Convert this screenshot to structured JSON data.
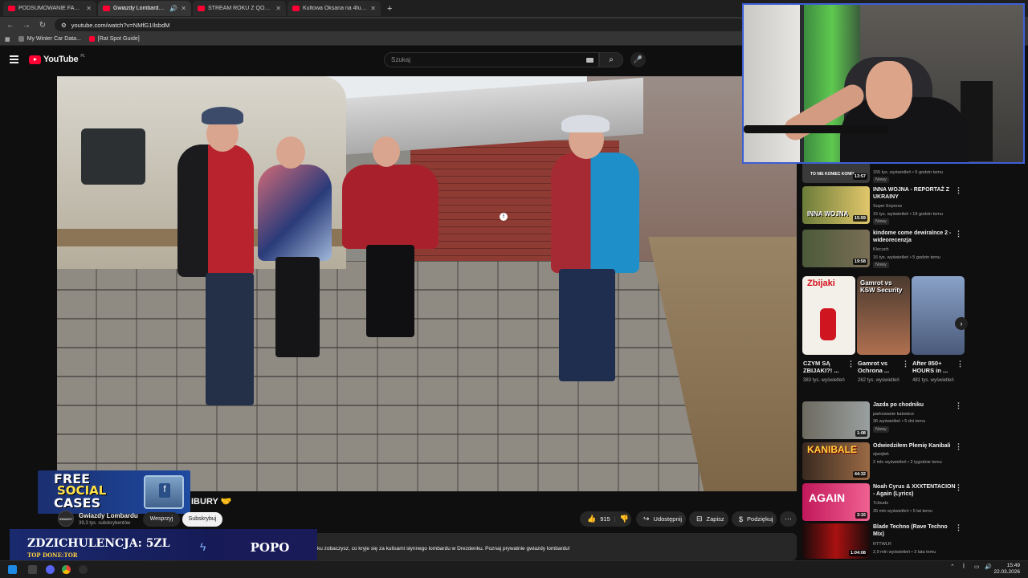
{
  "tabs": [
    {
      "title": "PODSUMOWANIE FAME 30 (Dł",
      "active": false
    },
    {
      "title": "Gwiazdy Lombardu: Gramy",
      "active": true
    },
    {
      "title": "STREAM ROKU Z QOOSIK | WS",
      "active": false
    },
    {
      "title": "Kultowa Oksana na 4fun.tv - dy",
      "active": false
    }
  ],
  "url": "youtube.com/watch?v=NMfG1IlsbdM",
  "bookmarks": [
    "My Winter Car Data...",
    "[Rat Spot Guide]"
  ],
  "youtube": {
    "logo": "YouTube",
    "region": "PL",
    "search_placeholder": "Szukaj"
  },
  "overlays": {
    "cases_line1": "FREE",
    "cases_line2": "SOCIAL",
    "cases_line3": "CASES",
    "donate_main": "ZDZICHULENCJA: 5ZL",
    "donate_sub": "TOP DONE:TOR",
    "donate_right": "POPO"
  },
  "video": {
    "title_fragment": "IBURY 🤝",
    "channel_name": "Gwiazdy Lombardu",
    "channel_avatar_text": "GWIAZDY LOMBARDU",
    "subscribers": "39,3 tys. subskrybentów",
    "support_label": "Wesprzyj",
    "subscribe_label": "Subskrybuj",
    "likes": "915",
    "share_label": "Udostępnij",
    "save_label": "Zapisz",
    "thanks_label": "Podziękuj",
    "description_fragment": "ku zobaczysz, co kryje się za kulisami słynnego lombardu w Drezdenku. Poznaj prywatnie gwiazdy lombardu!"
  },
  "recommendations": [
    {
      "title": "",
      "thumb_text": "TO NIE KONIEC KONFL",
      "duration": "13:57",
      "channel": "",
      "meta": "155 tys. wyświetleń • 5 godzin temu",
      "badge": "Nowy"
    },
    {
      "title": "INNA WOJNA - REPORTAŻ Z UKRAINY",
      "thumb_text": "INNA WOJNA",
      "duration": "15:59",
      "channel": "Super Express",
      "meta": "15 tys. wyświetleń • 19 godzin temu",
      "badge": "Nowy"
    },
    {
      "title": "kindome come dewiralnce 2 - wideorecenzja",
      "thumb_text": "",
      "duration": "19:58",
      "channel": "Klocuch",
      "meta": "16 tys. wyświetleń • 5 godzin temu",
      "badge": "Nowy"
    },
    {
      "title": "Jazda po chodniku",
      "thumb_text": "",
      "duration": "1:08",
      "channel": "parkowanie katowice",
      "meta": "36 wyświetleń • 5 dni temu",
      "badge": "Nowy"
    },
    {
      "title": "Odwiedziłem Plemię Kanibali",
      "thumb_text": "KANIBALE",
      "duration": "44:32",
      "channel": "ojwojtek",
      "meta": "2 mln wyświetleń • 2 tygodnie temu",
      "badge": ""
    },
    {
      "title": "Noah Cyrus & XXXTENTACION - Again (Lyrics)",
      "thumb_text": "AGAIN",
      "duration": "3:15",
      "channel": "7clouds",
      "meta": "35 mln wyświetleń • 5 lat temu",
      "badge": ""
    },
    {
      "title": "Blade Techno (Rave Techno Mix)",
      "thumb_text": "",
      "duration": "1:04:08",
      "channel": "RTTWLR",
      "meta": "2,9 mln wyświetleń • 3 lata temu",
      "badge": ""
    }
  ],
  "shorts": [
    {
      "thumb_text": "Zbijaki",
      "title": "CZYM SĄ ZBIJAKI?! ...",
      "views": "383 tys. wyświetleń"
    },
    {
      "thumb_text": "Gamrot vs KSW Security",
      "title": "Gamrot vs Ochrona ...",
      "views": "262 tys. wyświetleń"
    },
    {
      "thumb_text": "",
      "title": "After 850+ HOURS in ...",
      "views": "481 tys. wyświetleń"
    }
  ],
  "system": {
    "time": "15:49",
    "date": "22.03.2026"
  }
}
